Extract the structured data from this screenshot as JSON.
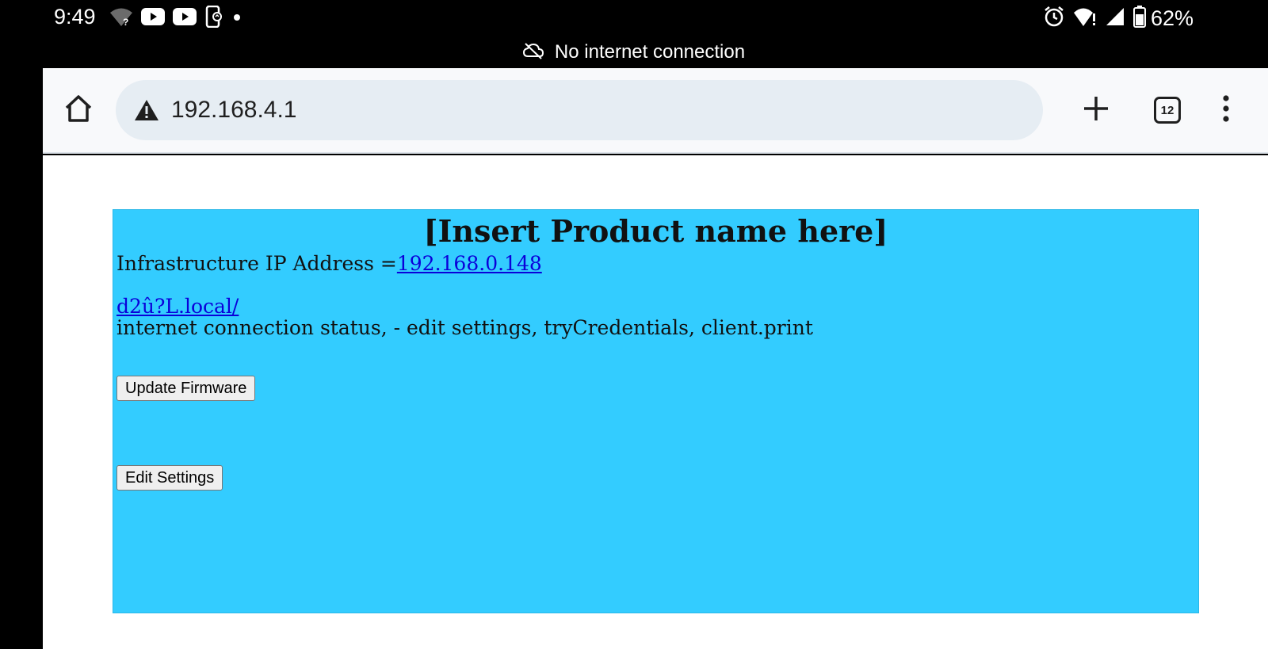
{
  "status_bar": {
    "time": "9:49",
    "left_icons": [
      "wifi-unknown-icon",
      "youtube-icon",
      "youtube-icon",
      "phone-sync-icon",
      "dot-icon"
    ],
    "right_icons": [
      "alarm-icon",
      "wifi-alert-icon",
      "cell-signal-icon",
      "battery-icon"
    ],
    "battery_percent": "62%"
  },
  "offline_banner": {
    "icon": "cloud-off-icon",
    "text": "No internet connection"
  },
  "browser": {
    "home_icon": "home-icon",
    "security_icon": "warning-icon",
    "url": "192.168.4.1",
    "new_tab_icon": "plus-icon",
    "tab_count": "12",
    "menu_icon": "more-vert-icon"
  },
  "page": {
    "background_color": "#33ccff",
    "title": "[Insert Product name here]",
    "ip_label": "Infrastructure IP Address =",
    "ip_link": "192.168.0.148",
    "local_link": "d2û?L.local/",
    "status_text": "internet connection status, - edit settings, tryCredentials, client.print",
    "update_firmware_label": "Update Firmware",
    "edit_settings_label": "Edit Settings"
  }
}
